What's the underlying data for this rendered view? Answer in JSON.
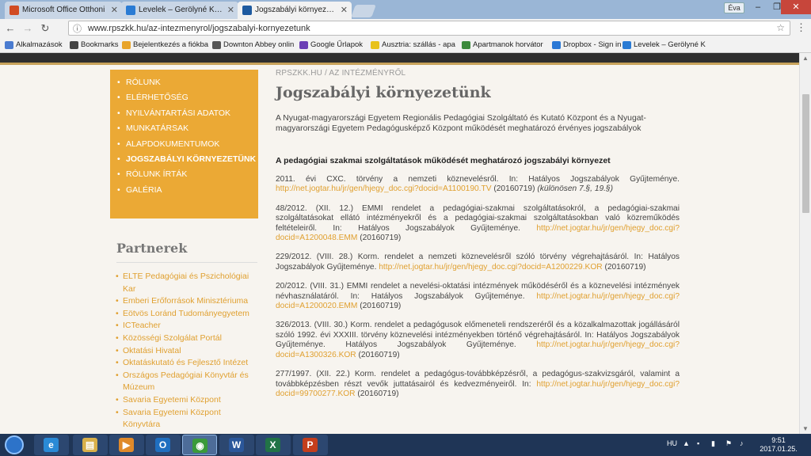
{
  "browser": {
    "tabs": [
      {
        "label": "Microsoft Office Otthoni",
        "color": "#d14b23"
      },
      {
        "label": "Levelek – Gerölyné Kölke",
        "color": "#2a7bd4"
      },
      {
        "label": "Jogszabályi környezetün",
        "color": "#1e5aa0",
        "active": true
      }
    ],
    "profile": "Éva",
    "url": "www.rpszkk.hu/az-intezmenyrol/jogszabalyi-kornyezetunk",
    "bookmarks": [
      {
        "label": "Alkalmazások",
        "color": "#4a7bd0"
      },
      {
        "label": "Bookmarks",
        "color": "#444444"
      },
      {
        "label": "Bejelentkezés a fiókba",
        "color": "#e8a42a"
      },
      {
        "label": "Downton Abbey onlin",
        "color": "#555555"
      },
      {
        "label": "Google Űrlapok",
        "color": "#6b3fb5"
      },
      {
        "label": "Ausztria: szállás - apa",
        "color": "#e8c21a"
      },
      {
        "label": "Apartmanok horvátor",
        "color": "#3c8a3c"
      },
      {
        "label": "Dropbox - Sign in",
        "color": "#2a78d6"
      },
      {
        "label": "Levelek – Gerölyné K",
        "color": "#2a7bd4"
      }
    ]
  },
  "nav": {
    "items": [
      {
        "label": "Rólunk"
      },
      {
        "label": "Elérhetőség"
      },
      {
        "label": "Nyilvántartási adatok"
      },
      {
        "label": "Munkatársak"
      },
      {
        "label": "Alapdokumentumok"
      },
      {
        "label": "Jogszabályi környezetünk",
        "active": true
      },
      {
        "label": "Rólunk írták"
      },
      {
        "label": "Galéria"
      }
    ]
  },
  "partners": {
    "title": "Partnerek",
    "items": [
      "ELTE Pedagógiai és Pszichológiai Kar",
      "Emberi Erőforrások Minisztériuma",
      "Eötvös Loránd Tudományegyetem",
      "ICTeacher",
      "Közösségi Szolgálat Portál",
      "Oktatási Hivatal",
      "Oktatáskutató és Fejlesztő Intézet",
      "Országos Pedagógiai Könyvtár és Múzeum",
      "Savaria Egyetemi Központ",
      "Savaria Egyetemi Központ Könyvtára"
    ]
  },
  "content": {
    "breadcrumb": "RPSZKK.HU / AZ INTÉZMÉNYRŐL",
    "title": "Jogszabályi környezetünk",
    "intro": "A Nyugat-magyarországi Egyetem Regionális Pedagógiai Szolgáltató és Kutató Központ és a Nyugat-magyarországi Egyetem Pedagógusképző Központ működését meghatározó érvényes jogszabályok",
    "subhead": "A pedagógiai szakmai szolgáltatások működését meghatározó jogszabályi környezet",
    "laws": [
      {
        "text": "2011. évi CXC. törvény a nemzeti köznevelésről. In: Hatályos Jogszabályok Gyűjteménye.",
        "link": "http://net.jogtar.hu/jr/gen/hjegy_doc.cgi?docid=A1100190.TV",
        "date": "(20160719)",
        "note": "(különösen 7.§, 19.§)"
      },
      {
        "text": "48/2012. (XII. 12.) EMMI rendelet a pedagógiai-szakmai szolgáltatásokról, a pedagógiai-szakmai szolgáltatásokat ellátó intézményekről és a pedagógiai-szakmai szolgáltatásokban való közreműködés feltételeiről. In: Hatályos Jogszabályok Gyűjteménye.",
        "link": "http://net.jogtar.hu/jr/gen/hjegy_doc.cgi?docid=A1200048.EMM",
        "date": "(20160719)"
      },
      {
        "text": "229/2012. (VIII. 28.) Korm. rendelet a nemzeti köznevelésről szóló törvény végrehajtásáról. In: Hatályos Jogszabályok Gyűjteménye.",
        "link": "http://net.jogtar.hu/jr/gen/hjegy_doc.cgi?docid=A1200229.KOR",
        "date": "(20160719)"
      },
      {
        "text": "20/2012. (VIII. 31.) EMMI rendelet a nevelési-oktatási intézmények működéséről és a köznevelési intézmények névhasználatáról. In: Hatályos Jogszabályok Gyűjteménye.",
        "link": "http://net.jogtar.hu/jr/gen/hjegy_doc.cgi?docid=A1200020.EMM",
        "date": "(20160719)"
      },
      {
        "text": "326/2013. (VIII. 30.) Korm. rendelet a pedagógusok előmeneteli rendszeréről és a közalkalmazottak jogállásáról szóló 1992. évi XXXIII. törvény köznevelési intézményekben történő végrehajtásáról. In: Hatályos Jogszabályok Gyűjteménye. Hatályos Jogszabályok Gyűjteménye.",
        "link": "http://net.jogtar.hu/jr/gen/hjegy_doc.cgi?docid=A1300326.KOR",
        "date": "(20160719)"
      },
      {
        "text": "277/1997. (XII. 22.) Korm. rendelet a pedagógus-továbbképzésről, a pedagógus-szakvizsgáról, valamint a továbbképzésben részt vevők juttatásairól és kedvezményeiről. In:",
        "link": "http://net.jogtar.hu/jr/gen/hjegy_doc.cgi?docid=99700277.KOR",
        "date": "(20160719)"
      }
    ]
  },
  "taskbar": {
    "apps": [
      {
        "name": "internet-explorer",
        "glyph": "e",
        "color": "#2a8ad6"
      },
      {
        "name": "file-explorer",
        "glyph": "▤",
        "color": "#d9b04a"
      },
      {
        "name": "media-player",
        "glyph": "▶",
        "color": "#e08a2a"
      },
      {
        "name": "outlook",
        "glyph": "O",
        "color": "#1f6fc0"
      },
      {
        "name": "chrome",
        "glyph": "◉",
        "color": "#3a9a3a",
        "active": true
      },
      {
        "name": "word",
        "glyph": "W",
        "color": "#2b579a"
      },
      {
        "name": "excel",
        "glyph": "X",
        "color": "#217346"
      },
      {
        "name": "powerpoint",
        "glyph": "P",
        "color": "#c43e1c"
      }
    ],
    "lang": "HU",
    "time": "9:51",
    "date": "2017.01.25."
  }
}
